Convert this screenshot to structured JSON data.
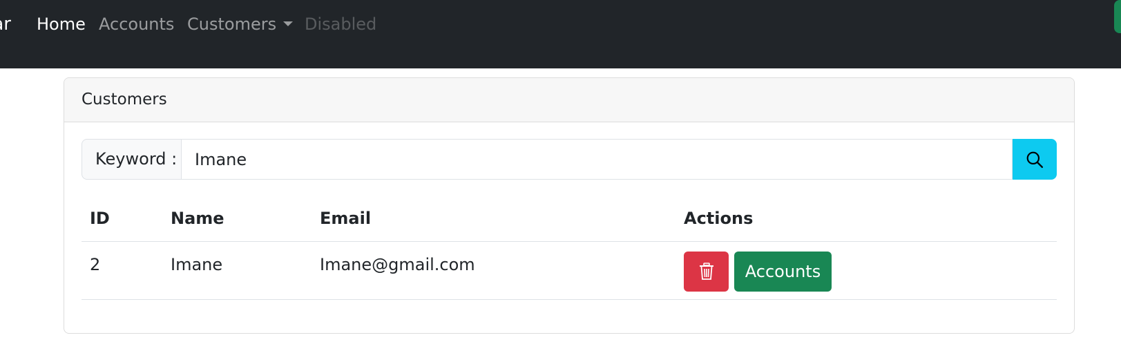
{
  "navbar": {
    "brand_fragment": "ar",
    "links": [
      {
        "label": "Home"
      },
      {
        "label": "Accounts"
      },
      {
        "label": "Customers"
      },
      {
        "label": "Disabled"
      }
    ]
  },
  "card": {
    "title": "Customers"
  },
  "search": {
    "label": "Keyword :",
    "value": "Imane",
    "button_icon": "search-icon"
  },
  "table": {
    "headers": [
      "ID",
      "Name",
      "Email",
      "Actions"
    ],
    "rows": [
      {
        "id": "2",
        "name": "Imane",
        "email": "Imane@gmail.com",
        "delete_icon": "trash-icon",
        "accounts_label": "Accounts"
      }
    ]
  },
  "colors": {
    "navbar_bg": "#212529",
    "search_button": "#0dcaf0",
    "delete_button": "#dc3545",
    "accounts_button": "#198754"
  }
}
